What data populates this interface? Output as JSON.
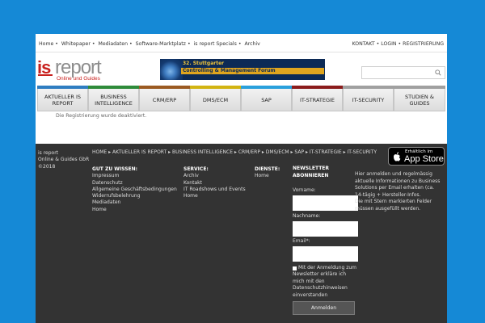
{
  "top_nav": {
    "links": [
      "Home",
      "Whitepaper",
      "Mediadaten",
      "Software-Marktplatz",
      "is report Specials",
      "Archiv"
    ],
    "account": [
      "KONTAKT",
      "LOGIN",
      "REGISTRIERUNG"
    ]
  },
  "logo": {
    "main": "report",
    "prefix": "is",
    "tagline": "Online und Guides"
  },
  "banner": {
    "line1": "32. Stuttgarter",
    "line2": "Controlling & Management Forum"
  },
  "search": {
    "placeholder": "",
    "icon": "search-icon"
  },
  "nav": {
    "items": [
      {
        "label": "AKTUELLER IS REPORT",
        "color": "#2f7dc1"
      },
      {
        "label": "BUSINESS INTELLIGENCE",
        "color": "#2e8b3a"
      },
      {
        "label": "CRM/ERP",
        "color": "#9b5a22"
      },
      {
        "label": "DMS/ECM",
        "color": "#d2b412"
      },
      {
        "label": "SAP",
        "color": "#2aa0dc"
      },
      {
        "label": "IT-STRATEGIE",
        "color": "#8b1c1c"
      },
      {
        "label": "IT-SECURITY",
        "color": "#a0a0a0"
      },
      {
        "label": "STUDIEN & GUIDES",
        "color": "#a0a0a0"
      }
    ]
  },
  "notice": "Die Registrierung wurde deaktiviert.",
  "footer": {
    "copyright": [
      "is report",
      "Online & Guides GbR",
      "©2018"
    ],
    "breadcrumbs": [
      "HOME",
      "AKTUELLER IS REPORT",
      "BUSINESS INTELLIGENCE",
      "CRM/ERP",
      "DMS/ECM",
      "SAP",
      "IT-STRATEGIE",
      "IT-SECURITY"
    ],
    "app_store": {
      "small": "Erhältlich im",
      "big": "App Store"
    },
    "gut_zu_wissen": {
      "title": "GUT ZU WISSEN:",
      "items": [
        "Impressum",
        "Datenschutz",
        "Allgemeine Geschäftsbedingungen",
        "Widerrufsbelehrung",
        "Mediadaten",
        "Home"
      ]
    },
    "service": {
      "title": "SERVICE:",
      "items": [
        "Archiv",
        "Kontakt",
        "IT Roadshows und Events",
        "Home"
      ]
    },
    "dienste": {
      "title": "DIENSTE:",
      "items": [
        "Home"
      ]
    },
    "newsletter": {
      "title": "NEWSLETTER ABONNIEREN",
      "fields": [
        {
          "label": "Vorname:",
          "value": ""
        },
        {
          "label": "Nachname:",
          "value": ""
        },
        {
          "label": "Email*:",
          "value": ""
        }
      ],
      "consent": "Mit der Anmeldung zum Newsletter erkläre ich mich mit den Datenschutzhinweisen einverstanden",
      "button": "Anmelden",
      "info": "Hier anmelden und regelmässig aktuelle Informationen zu Business Solutions per Email erhalten (ca. 14-tägig + Hersteller-Infos.",
      "required_note": "Die mit Stern markierten Felder müssen ausgefüllt werden."
    }
  }
}
